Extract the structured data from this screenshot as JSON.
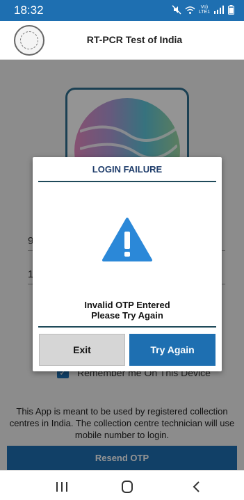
{
  "status_bar": {
    "time": "18:32",
    "volte_line1": "Vo)",
    "volte_line2": "LTE1"
  },
  "header": {
    "title": "RT-PCR Test of India"
  },
  "background": {
    "field_fragment_1": "9",
    "field_fragment_2": "1",
    "remember_label": "Remember me On This Device",
    "notice": "This App is meant to be used by registered collection centres in India. The collection centre technician will use mobile number to login.",
    "resend_label": "Resend OTP"
  },
  "dialog": {
    "title": "LOGIN FAILURE",
    "message_line1": "Invalid OTP Entered",
    "message_line2": "Please Try Again",
    "exit_label": "Exit",
    "try_again_label": "Try Again",
    "icon": "warning-icon"
  },
  "nav": {
    "recents": "recents-icon",
    "home": "home-icon",
    "back": "back-icon"
  },
  "colors": {
    "primary": "#1e6fb1",
    "dialog_rule": "#1f4a5a",
    "warning": "#2b88d8"
  }
}
